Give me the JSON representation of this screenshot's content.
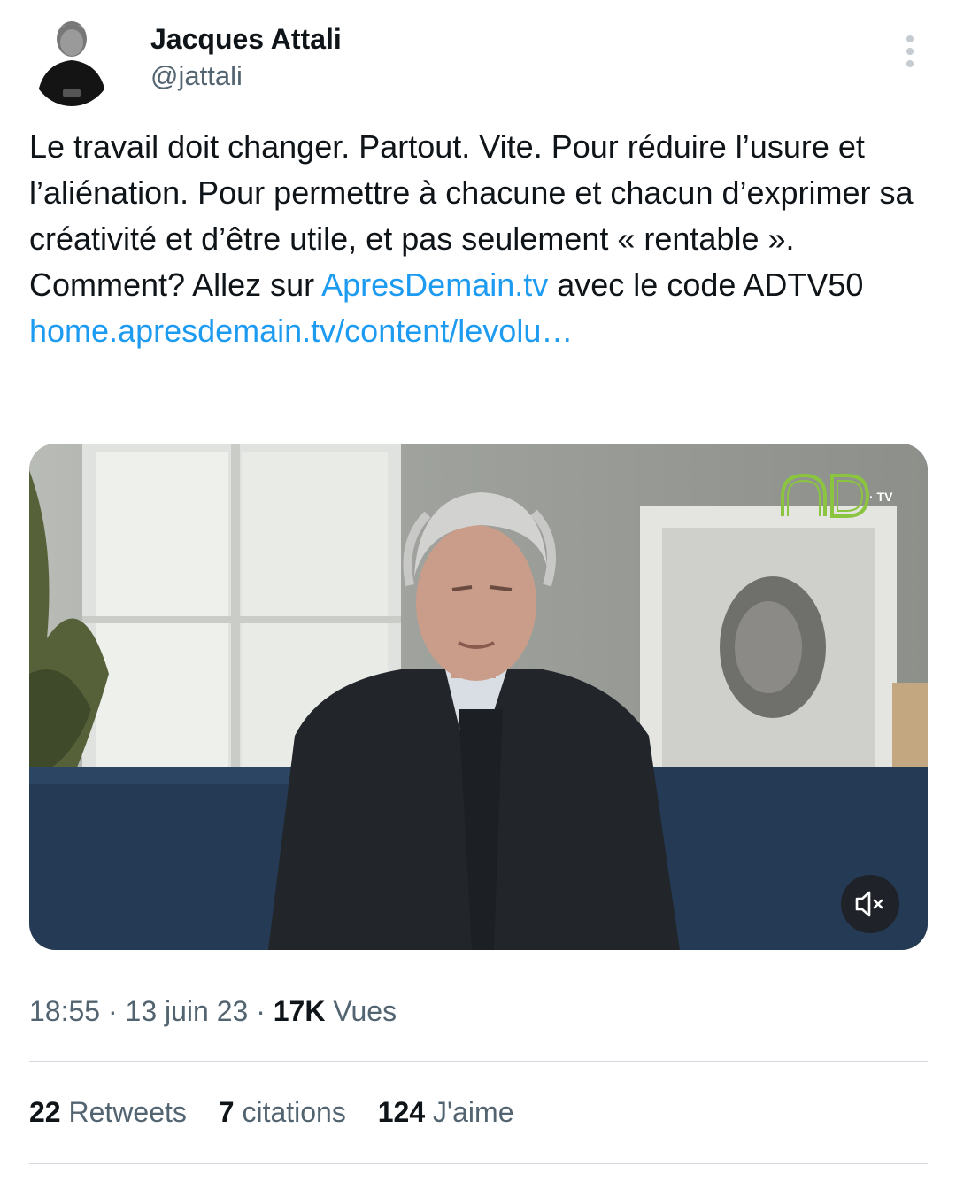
{
  "author": {
    "name": "Jacques Attali",
    "handle": "@jattali"
  },
  "tweet": {
    "text_parts": [
      "Le travail doit changer. Partout. Vite. Pour réduire l’usure et l’aliénation. Pour permettre à chacune et chacun d’exprimer sa créativité et d’être utile, et pas seulement « rentable ». Comment? Allez sur ",
      " avec le code ADTV50"
    ],
    "link1": "ApresDemain.tv",
    "link2": "home.apresdemain.tv/content/levolu…"
  },
  "media": {
    "brand_suffix": "· TV",
    "mute_icon": "volume-muted-icon"
  },
  "meta": {
    "time": "18:55",
    "separator": " · ",
    "date": "13 juin 23",
    "views_count": "17K",
    "views_label": "Vues"
  },
  "stats": {
    "retweets_count": "22",
    "retweets_label": "Retweets",
    "quotes_count": "7",
    "quotes_label": "citations",
    "likes_count": "124",
    "likes_label": "J'aime"
  },
  "colors": {
    "link": "#1d9bf0",
    "secondary_text": "#536471",
    "logo_green": "#8bc53f"
  }
}
